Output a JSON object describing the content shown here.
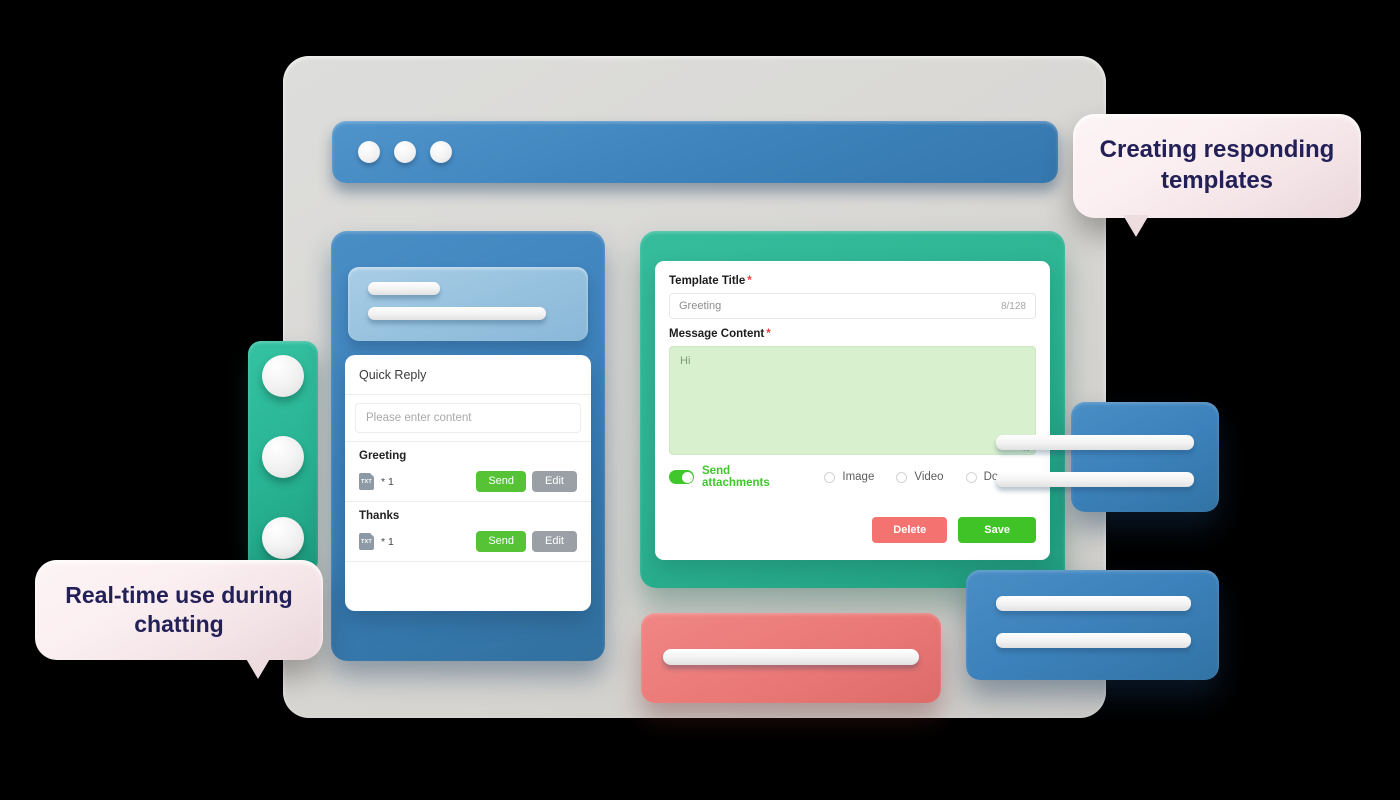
{
  "window": {
    "titlebar_dots": [
      "dot-1",
      "dot-2",
      "dot-3"
    ]
  },
  "quick_reply_panel": {
    "title": "Quick Reply",
    "search_placeholder": "Please enter content",
    "items": [
      {
        "name": "Greeting",
        "attachment_icon": "txt-file-icon",
        "attachment_icon_label": "TXT",
        "count": "* 1",
        "send_label": "Send",
        "edit_label": "Edit"
      },
      {
        "name": "Thanks",
        "attachment_icon": "txt-file-icon",
        "attachment_icon_label": "TXT",
        "count": "* 1",
        "send_label": "Send",
        "edit_label": "Edit"
      }
    ]
  },
  "template_form": {
    "title_label": "Template Title",
    "title_required_mark": "*",
    "title_value": "Greeting",
    "title_char_count": "8/128",
    "content_label": "Message Content",
    "content_required_mark": "*",
    "content_value": "Hi",
    "attachments": {
      "toggle_on": true,
      "toggle_label": "Send attachments",
      "options": [
        {
          "label": "Image",
          "selected": false
        },
        {
          "label": "Video",
          "selected": false
        },
        {
          "label": "Document",
          "selected": false
        }
      ]
    },
    "delete_label": "Delete",
    "save_label": "Save"
  },
  "callouts": [
    {
      "text": "Creating responding templates"
    },
    {
      "text": "Real-time use during chatting"
    }
  ],
  "colors": {
    "accent_blue": "#3d82bb",
    "accent_teal": "#2cb493",
    "green": "#40c326",
    "red": "#f4726f",
    "grey": "#9aa0a6",
    "required": "#e8413a",
    "panel_grey": "#d9d8d5",
    "textarea_green": "#d9f0cf",
    "bubble_text": "#232058"
  }
}
